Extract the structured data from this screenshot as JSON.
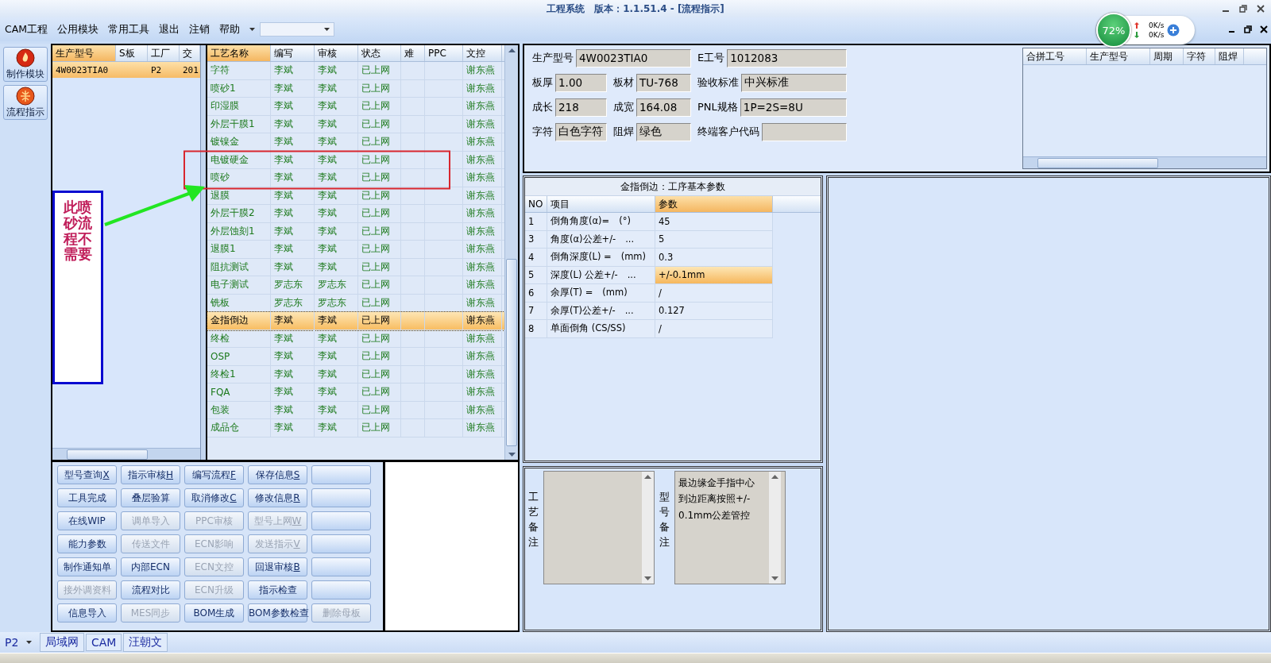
{
  "window": {
    "title": "工程系统　版本：1.1.51.4 - [流程指示]"
  },
  "menu": {
    "items": [
      "CAM工程",
      "公用模块",
      "常用工具",
      "退出",
      "注销",
      "帮助"
    ]
  },
  "net_monitor": {
    "percent": "72%",
    "upload": "0K/s",
    "download": "0K/s"
  },
  "nav": [
    {
      "label": "制作模块"
    },
    {
      "label": "流程指示"
    }
  ],
  "model_grid": {
    "columns": [
      "生产型号",
      "S板",
      "工厂",
      "交"
    ],
    "rows": [
      {
        "model": "4W0023TIA0",
        "factory": "P2",
        "column_4": "201",
        "selected": true
      }
    ]
  },
  "process_grid": {
    "columns": [
      "工艺名称",
      "编写",
      "审核",
      "状态",
      "难",
      "PPC",
      "文控"
    ],
    "rows": [
      {
        "name": "字符",
        "writer": "李斌",
        "reviewer": "李斌",
        "status": "已上网",
        "doc_control": "谢东燕",
        "selected": false
      },
      {
        "name": "喷砂1",
        "writer": "李斌",
        "reviewer": "李斌",
        "status": "已上网",
        "doc_control": "谢东燕",
        "selected": false
      },
      {
        "name": "印湿膜",
        "writer": "李斌",
        "reviewer": "李斌",
        "status": "已上网",
        "doc_control": "谢东燕",
        "selected": false
      },
      {
        "name": "外层干膜1",
        "writer": "李斌",
        "reviewer": "李斌",
        "status": "已上网",
        "doc_control": "谢东燕",
        "selected": false
      },
      {
        "name": "镀镍金",
        "writer": "李斌",
        "reviewer": "李斌",
        "status": "已上网",
        "doc_control": "谢东燕",
        "selected": false
      },
      {
        "name": "电镀硬金",
        "writer": "李斌",
        "reviewer": "李斌",
        "status": "已上网",
        "doc_control": "谢东燕",
        "selected": false
      },
      {
        "name": "喷砂",
        "writer": "李斌",
        "reviewer": "李斌",
        "status": "已上网",
        "doc_control": "谢东燕",
        "selected": false
      },
      {
        "name": "退膜",
        "writer": "李斌",
        "reviewer": "李斌",
        "status": "已上网",
        "doc_control": "谢东燕",
        "selected": false
      },
      {
        "name": "外层干膜2",
        "writer": "李斌",
        "reviewer": "李斌",
        "status": "已上网",
        "doc_control": "谢东燕",
        "selected": false
      },
      {
        "name": "外层蚀刻1",
        "writer": "李斌",
        "reviewer": "李斌",
        "status": "已上网",
        "doc_control": "谢东燕",
        "selected": false
      },
      {
        "name": "退膜1",
        "writer": "李斌",
        "reviewer": "李斌",
        "status": "已上网",
        "doc_control": "谢东燕",
        "selected": false
      },
      {
        "name": "阻抗测试",
        "writer": "李斌",
        "reviewer": "李斌",
        "status": "已上网",
        "doc_control": "谢东燕",
        "selected": false
      },
      {
        "name": "电子测试",
        "writer": "罗志东",
        "reviewer": "罗志东",
        "status": "已上网",
        "doc_control": "谢东燕",
        "selected": false
      },
      {
        "name": "铣板",
        "writer": "罗志东",
        "reviewer": "罗志东",
        "status": "已上网",
        "doc_control": "谢东燕",
        "selected": false
      },
      {
        "name": "金指倒边",
        "writer": "李斌",
        "reviewer": "李斌",
        "status": "已上网",
        "doc_control": "谢东燕",
        "selected": true
      },
      {
        "name": "终检",
        "writer": "李斌",
        "reviewer": "李斌",
        "status": "已上网",
        "doc_control": "谢东燕",
        "selected": false
      },
      {
        "name": "OSP",
        "writer": "李斌",
        "reviewer": "李斌",
        "status": "已上网",
        "doc_control": "谢东燕",
        "selected": false
      },
      {
        "name": "终检1",
        "writer": "李斌",
        "reviewer": "李斌",
        "status": "已上网",
        "doc_control": "谢东燕",
        "selected": false
      },
      {
        "name": "FQA",
        "writer": "李斌",
        "reviewer": "李斌",
        "status": "已上网",
        "doc_control": "谢东燕",
        "selected": false
      },
      {
        "name": "包装",
        "writer": "李斌",
        "reviewer": "李斌",
        "status": "已上网",
        "doc_control": "谢东燕",
        "selected": false
      },
      {
        "name": "成品仓",
        "writer": "李斌",
        "reviewer": "李斌",
        "status": "已上网",
        "doc_control": "谢东燕",
        "selected": false
      }
    ]
  },
  "annotation": {
    "text": "此喷砂流程不需要"
  },
  "buttons": [
    {
      "label": "型号查询",
      "accel": "X",
      "disabled": false
    },
    {
      "label": "指示审核",
      "accel": "H",
      "disabled": false
    },
    {
      "label": "编写流程",
      "accel": "F",
      "disabled": false
    },
    {
      "label": "保存信息",
      "accel": "S",
      "disabled": false
    },
    {
      "disabled": false
    },
    {
      "label": "工具完成",
      "disabled": false
    },
    {
      "label": "叠层验算",
      "disabled": false
    },
    {
      "label": "取消修改",
      "accel": "C",
      "disabled": false
    },
    {
      "label": "修改信息",
      "accel": "R",
      "disabled": false
    },
    {
      "disabled": false
    },
    {
      "label": "在线WIP",
      "disabled": false
    },
    {
      "label": "调单导入",
      "disabled": true
    },
    {
      "label": "PPC审核",
      "disabled": true
    },
    {
      "label": "型号上网",
      "accel": "W",
      "disabled": true
    },
    {
      "disabled": false
    },
    {
      "label": "能力参数",
      "disabled": false
    },
    {
      "label": "传送文件",
      "disabled": true
    },
    {
      "label": "ECN影响",
      "disabled": true
    },
    {
      "label": "发送指示",
      "accel": "V",
      "disabled": true
    },
    {
      "disabled": false
    },
    {
      "label": "制作通知单",
      "disabled": false
    },
    {
      "label": "内部ECN",
      "disabled": false
    },
    {
      "label": "ECN文控",
      "disabled": true
    },
    {
      "label": "回退审核",
      "accel": "B",
      "disabled": false
    },
    {
      "disabled": false
    },
    {
      "label": "接外调资料",
      "disabled": true
    },
    {
      "label": "流程对比",
      "disabled": false
    },
    {
      "label": "ECN升级",
      "disabled": true
    },
    {
      "label": "指示检查",
      "disabled": false
    },
    {
      "disabled": false
    },
    {
      "label": "信息导入",
      "disabled": false
    },
    {
      "label": "MES同步",
      "disabled": true
    },
    {
      "label": "BOM生成",
      "disabled": false
    },
    {
      "label": "BOM参数检查",
      "disabled": false
    },
    {
      "label": "删除母板",
      "disabled": true
    }
  ],
  "info": {
    "fields": [
      {
        "label": "生产型号",
        "value": "4W0023TIA0"
      },
      {
        "label": "E工号",
        "value": "1012083"
      },
      {
        "label": "板厚",
        "value": "1.00"
      },
      {
        "label": "板材",
        "value": "TU-768"
      },
      {
        "label": "验收标准",
        "value": "中兴标准"
      },
      {
        "label": "成长",
        "value": "218"
      },
      {
        "label": "成宽",
        "value": "164.08"
      },
      {
        "label": "PNL规格",
        "value": "1P=2S=8U"
      },
      {
        "label": "字符",
        "value": "白色字符"
      },
      {
        "label": "阻焊",
        "value": "绿色"
      },
      {
        "label": "终端客户代码"
      }
    ]
  },
  "merge_grid": {
    "columns": [
      "合拼工号",
      "生产型号",
      "周期",
      "字符",
      "阻焊"
    ]
  },
  "params": {
    "title": "金指倒边：工序基本参数",
    "columns": [
      "NO",
      "项目",
      "参数"
    ],
    "rows": [
      {
        "no": "1",
        "item": "倒角角度(α)=　(°)",
        "value": "45",
        "selected": false
      },
      {
        "no": "3",
        "item": "角度(α)公差+/-　...",
        "value": "5",
        "selected": false
      },
      {
        "no": "4",
        "item": "倒角深度(L) =　(mm)",
        "value": "0.3",
        "selected": false
      },
      {
        "no": "5",
        "item": "深度(L) 公差+/-　...",
        "value": "+/-0.1mm",
        "selected": true
      },
      {
        "no": "6",
        "item": "余厚(T) =　(mm)",
        "value": "/",
        "selected": false
      },
      {
        "no": "7",
        "item": "余厚(T)公差+/-　...",
        "value": "0.127",
        "selected": false
      },
      {
        "no": "8",
        "item": "单面倒角 (CS/SS)",
        "value": "/",
        "selected": false
      }
    ]
  },
  "notes": [
    {
      "label": "工艺备注"
    },
    {
      "label": "型号备注",
      "text": "最边缘金手指中心到边距离按照+/-0.1mm公差管控"
    }
  ],
  "status_bar": {
    "combo": "P2",
    "items": [
      "局域网",
      "CAM",
      "汪朝文"
    ]
  }
}
